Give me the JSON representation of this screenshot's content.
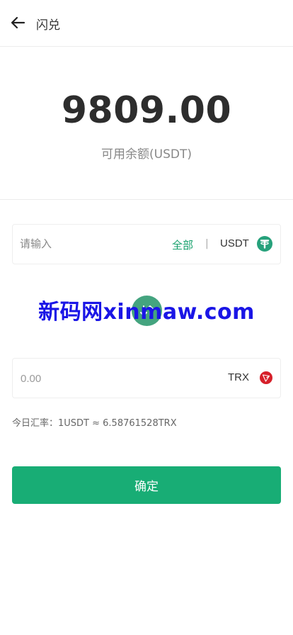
{
  "header": {
    "title": "闪兑",
    "back_icon": "arrow-left-icon"
  },
  "balance": {
    "amount": "9809.00",
    "label": "可用余额(USDT)"
  },
  "from": {
    "placeholder": "请输入",
    "all_label": "全部",
    "divider": "|",
    "coin": "USDT",
    "coin_icon": "tether-icon",
    "coin_color": "#26a17b"
  },
  "swap": {
    "icon": "swap-icon",
    "color": "#44a47f"
  },
  "watermark": "新码网xinmaw.com",
  "to": {
    "value": "0.00",
    "coin": "TRX",
    "coin_icon": "tron-icon",
    "coin_color": "#d6202a"
  },
  "rate": {
    "text": "今日汇率：1USDT ≈ 6.58761528TRX"
  },
  "confirm": {
    "label": "确定",
    "color": "#18ad75"
  },
  "accent_color": "#16a06c"
}
